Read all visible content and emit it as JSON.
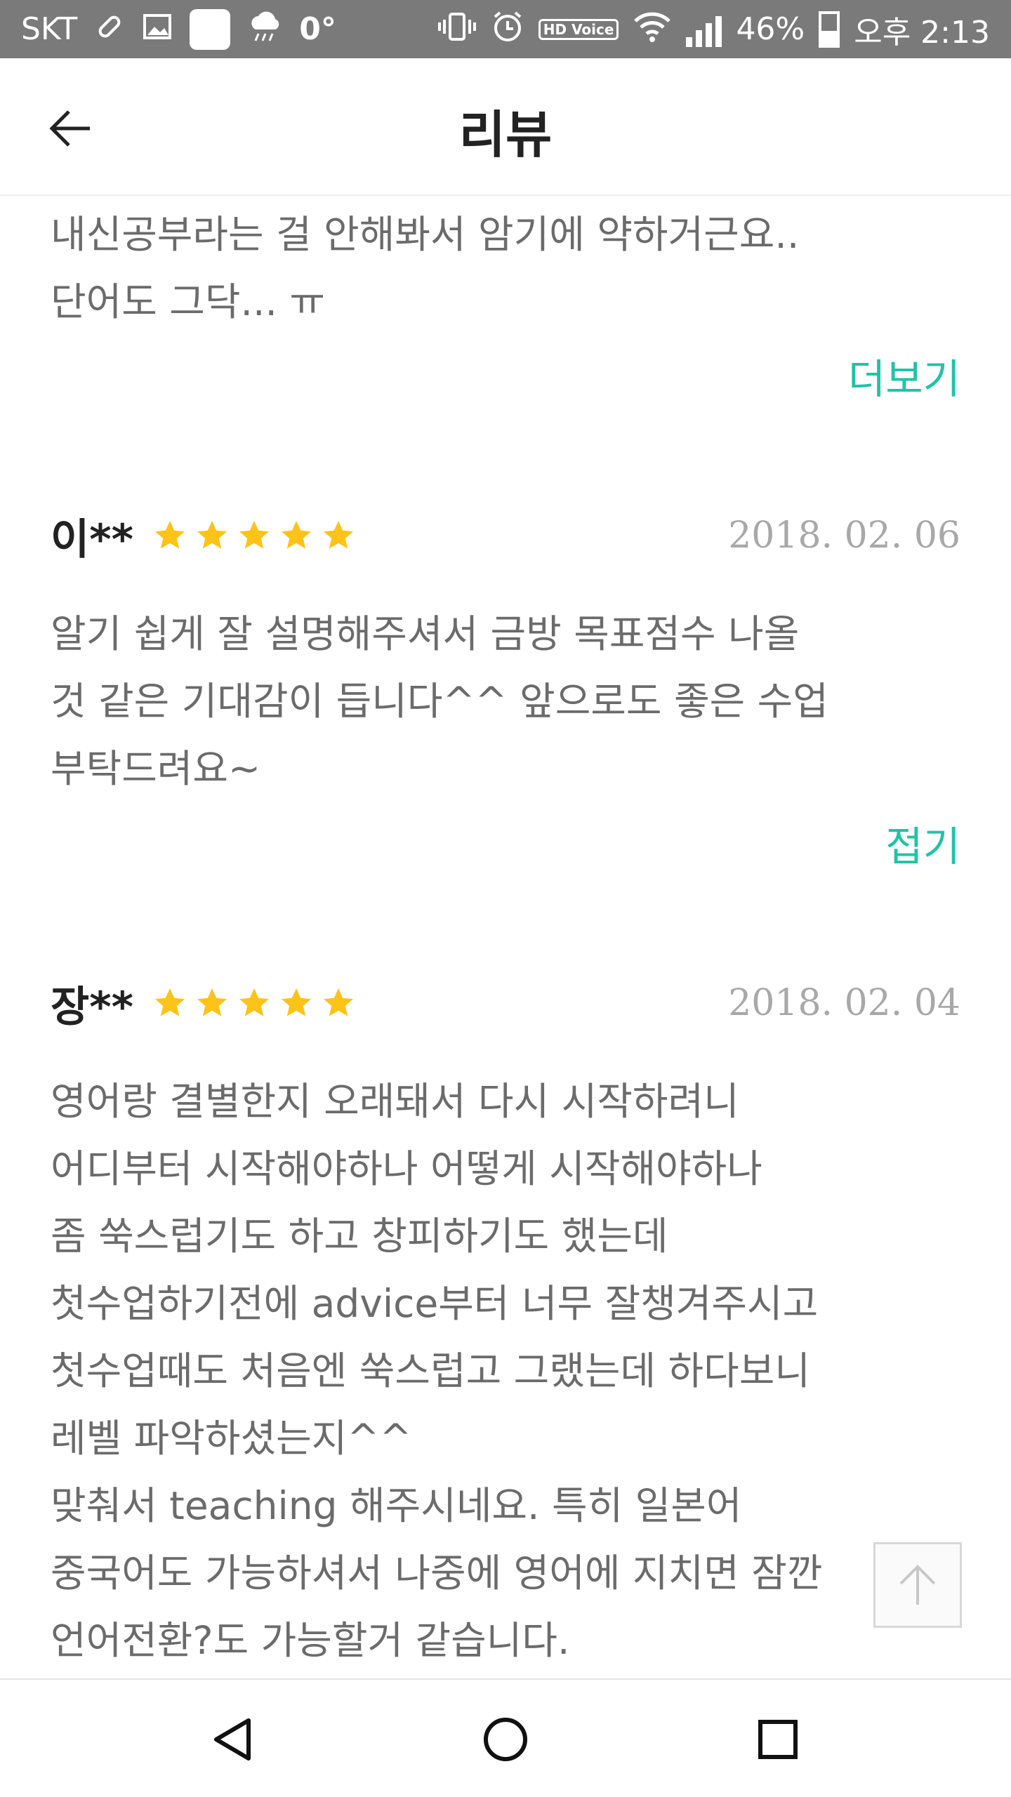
{
  "status_bar": {
    "carrier": "SKT",
    "temperature": "0°",
    "battery_percent": "46%",
    "time": "오후 2:13",
    "hd_voice": "HD Voice",
    "icons": [
      "bandage-icon",
      "image-icon",
      "square-notification-icon",
      "rain-cloud-icon",
      "vibrate-icon",
      "alarm-icon",
      "hd-voice-icon",
      "wifi-icon",
      "signal-icon",
      "battery-icon"
    ]
  },
  "app_bar": {
    "title": "리뷰",
    "back_icon": "arrow-left-icon"
  },
  "reviews": [
    {
      "text": "내신공부라는 걸 안해봐서 암기에 약하거근요..\n단어도 그닥... ㅠ",
      "toggle_label": "더보기"
    },
    {
      "author": "이**",
      "rating": 5,
      "date": "2018. 02. 06",
      "text": "알기 쉽게 잘 설명해주셔서 금방 목표점수 나올\n것 같은 기대감이 듭니다^^ 앞으로도 좋은 수업\n부탁드려요~",
      "toggle_label": "접기"
    },
    {
      "author": "장**",
      "rating": 5,
      "date": "2018. 02. 04",
      "text": "영어랑 결별한지 오래돼서 다시 시작하려니\n어디부터 시작해야하나 어떻게 시작해야하나\n좀 쑥스럽기도 하고 창피하기도 했는데\n첫수업하기전에  advice부터 너무 잘챙겨주시고\n첫수업때도 처음엔 쑥스럽고 그랬는데 하다보니\n레벨 파악하셨는지^^\n맞춰서 teaching 해주시네요. 특히 일본어\n중국어도 가능하셔서 나중에 영어에 지치면 잠깐\n언어전환?도 가능할거 같습니다."
    }
  ],
  "colors": {
    "accent": "#20c3a6",
    "star": "#fdc318",
    "status_bar": "#7a7a7a"
  },
  "scroll_top_icon": "arrow-up-icon",
  "nav_bar": {
    "icons": [
      "back-triangle-icon",
      "home-circle-icon",
      "recents-square-icon"
    ]
  }
}
